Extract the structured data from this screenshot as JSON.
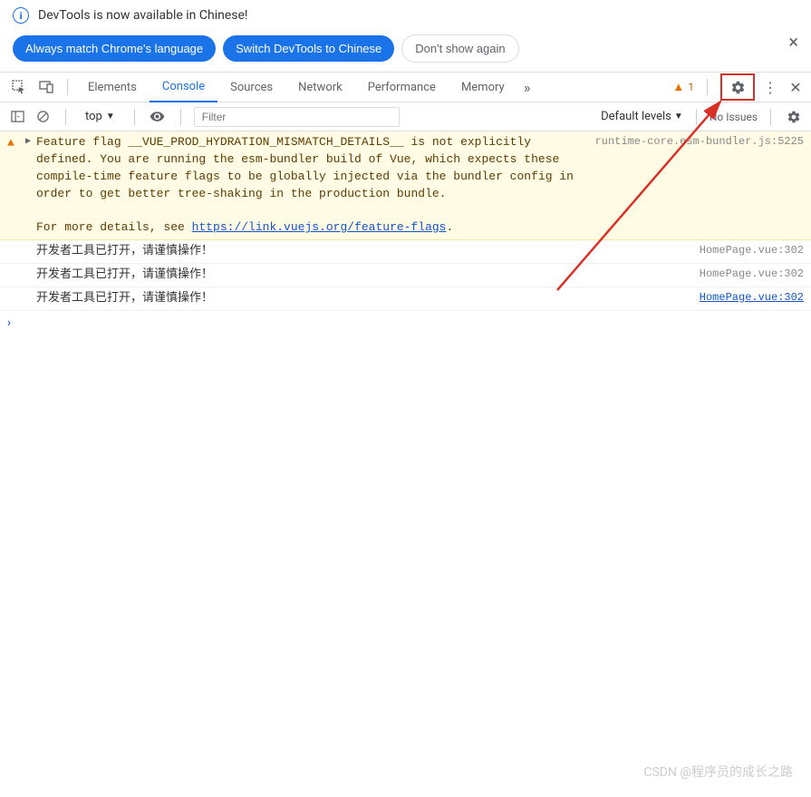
{
  "infobar": {
    "text": "DevTools is now available in Chinese!"
  },
  "buttons": {
    "match": "Always match Chrome's language",
    "switch": "Switch DevTools to Chinese",
    "dont": "Don't show again"
  },
  "tabs": {
    "elements": "Elements",
    "console": "Console",
    "sources": "Sources",
    "network": "Network",
    "performance": "Performance",
    "memory": "Memory"
  },
  "warn_count": "1",
  "toolbar": {
    "context": "top",
    "filter_placeholder": "Filter",
    "levels": "Default levels",
    "issues": "No Issues"
  },
  "logs": {
    "warn_msg_1": "Feature flag __VUE_PROD_HYDRATION_MISMATCH_DETAILS__ is not explicitly defined. You are running the esm-bundler build of Vue, which expects these compile-time feature flags to be globally injected via the bundler config in order to get better tree-shaking in the production bundle.",
    "warn_msg_2a": "For more details, see ",
    "warn_link": "https://link.vuejs.org/feature-flags",
    "warn_msg_2b": ".",
    "warn_src": "runtime-core.esm-bundler.js:5225",
    "msg1": "开发者工具已打开，请谨慎操作！",
    "src1": "HomePage.vue:302",
    "msg2": "开发者工具已打开，请谨慎操作！",
    "src2": "HomePage.vue:302",
    "msg3": "开发者工具已打开，请谨慎操作！",
    "src3": "HomePage.vue:302"
  },
  "watermark": "CSDN @程序员的成长之路"
}
